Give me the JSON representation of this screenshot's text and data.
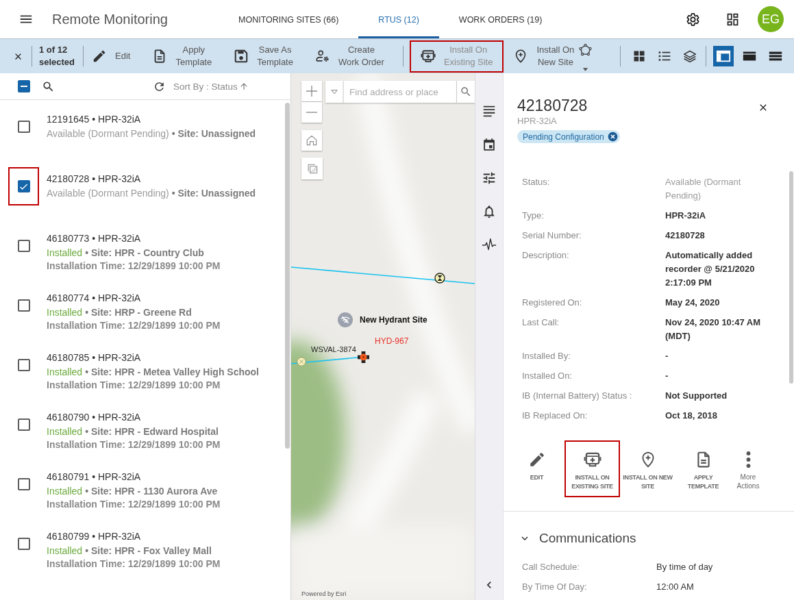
{
  "header": {
    "title": "Remote Monitoring",
    "tabs": [
      {
        "label": "MONITORING SITES (66)",
        "selected": false
      },
      {
        "label": "RTUS (12)",
        "selected": true
      },
      {
        "label": "WORK ORDERS (19)",
        "selected": false
      }
    ],
    "avatar": "EG"
  },
  "toolbar": {
    "selection": "1 of 12\nselected",
    "actions": [
      {
        "kind": "edit",
        "label": "Edit"
      },
      {
        "kind": "apply-template",
        "label": "Apply\nTemplate"
      },
      {
        "kind": "save-template",
        "label": "Save As\nTemplate"
      },
      {
        "kind": "work-order",
        "label": "Create\nWork Order"
      }
    ],
    "install_actions": [
      {
        "kind": "install-existing",
        "label": "Install On\nExisting Site",
        "disabled": true,
        "highlighted": true
      },
      {
        "kind": "install-new",
        "label": "Install On\nNew Site",
        "disabled": false,
        "highlighted": false
      }
    ],
    "view_modes": [
      {
        "selected": true
      },
      {
        "selected": false
      },
      {
        "selected": false
      }
    ]
  },
  "list": {
    "select_all": {
      "indeterminate": true
    },
    "sort": "Sort By : Status",
    "rows": [
      {
        "title": "12191645 • HPR-32iA",
        "status": {
          "text": "Available (Dormant Pending)",
          "color": "#9b9b9b"
        },
        "site": "• Site: Unassigned",
        "checked": false,
        "highlighted": false
      },
      {
        "title": "42180728 • HPR-32iA",
        "status": {
          "text": "Available (Dormant Pending)",
          "color": "#9b9b9b"
        },
        "site": "• Site: Unassigned",
        "checked": true,
        "highlighted": true
      },
      {
        "title": "46180773 • HPR-32iA",
        "status": {
          "text": "Installed",
          "color": "#6cab3e"
        },
        "site": "• Site: HPR - Country Club",
        "time": "Installation Time: 12/29/1899 10:00 PM",
        "checked": false,
        "highlighted": false
      },
      {
        "title": "46180774 • HPR-32iA",
        "status": {
          "text": "Installed",
          "color": "#6cab3e"
        },
        "site": "• Site: HRP - Greene Rd",
        "time": "Installation Time: 12/29/1899 10:00 PM",
        "checked": false,
        "highlighted": false
      },
      {
        "title": "46180785 • HPR-32iA",
        "status": {
          "text": "Installed",
          "color": "#6cab3e"
        },
        "site": "• Site: HPR - Metea Valley High School",
        "time": "Installation Time: 12/29/1899 10:00 PM",
        "checked": false,
        "highlighted": false
      },
      {
        "title": "46180790 • HPR-32iA",
        "status": {
          "text": "Installed",
          "color": "#6cab3e"
        },
        "site": "• Site: HPR - Edward Hospital",
        "time": "Installation Time: 12/29/1899 10:00 PM",
        "checked": false,
        "highlighted": false
      },
      {
        "title": "46180791 • HPR-32iA",
        "status": {
          "text": "Installed",
          "color": "#6cab3e"
        },
        "site": "• Site: HPR - 1130 Aurora Ave",
        "time": "Installation Time: 12/29/1899 10:00 PM",
        "checked": false,
        "highlighted": false
      },
      {
        "title": "46180799 • HPR-32iA",
        "status": {
          "text": "Installed",
          "color": "#6cab3e"
        },
        "site": "• Site: HPR - Fox Valley Mall",
        "time": "Installation Time: 12/29/1899 10:00 PM",
        "checked": false,
        "highlighted": false
      }
    ]
  },
  "map": {
    "search": {
      "placeholder": "Find address or place"
    },
    "features": [
      {
        "kind": "site",
        "label": "New Hydrant Site"
      },
      {
        "kind": "hydrant",
        "label": "HYD-967"
      },
      {
        "kind": "valve",
        "label": "WSVAL-3874"
      }
    ],
    "attribution": "Powered by Esri"
  },
  "details": {
    "title": "42180728",
    "subtitle": "HPR-32iA",
    "chip": "Pending Configuration",
    "fields": [
      {
        "label": "Status:",
        "value": "Available (Dormant Pending)",
        "muted": true
      },
      {
        "label": "Type:",
        "value": "HPR-32iA",
        "muted": false
      },
      {
        "label": "Serial Number:",
        "value": "42180728",
        "muted": false
      },
      {
        "label": "Description:",
        "value": "Automatically added recorder @ 5/21/2020 2:17:09 PM",
        "muted": false
      },
      {
        "label": "Registered On:",
        "value": "May 24, 2020",
        "muted": false
      },
      {
        "label": "Last Call:",
        "value": "Nov 24, 2020 10:47 AM (MDT)",
        "muted": false
      },
      {
        "label": "Installed By:",
        "value": "-",
        "muted": false
      },
      {
        "label": "Installed On:",
        "value": "-",
        "muted": false
      },
      {
        "label": "IB (Internal Battery) Status :",
        "value": "Not Supported",
        "muted": false
      },
      {
        "label": "IB Replaced On:",
        "value": "Oct 18, 2018",
        "muted": false
      }
    ],
    "actions": [
      {
        "kind": "edit",
        "label": "EDIT",
        "highlighted": false
      },
      {
        "kind": "install-existing",
        "label": "INSTALL ON EXISTING SITE",
        "highlighted": true
      },
      {
        "kind": "install-new",
        "label": "INSTALL ON NEW SITE",
        "highlighted": false
      },
      {
        "kind": "apply-template",
        "label": "APPLY TEMPLATE",
        "highlighted": false
      },
      {
        "kind": "more",
        "label": "More Actions",
        "highlighted": false
      }
    ],
    "sections": [
      {
        "title": "Communications",
        "expanded": true,
        "fields": [
          {
            "label": "Call Schedule:",
            "value": "By time of day"
          },
          {
            "label": "By Time Of Day:",
            "value": "12:00 AM"
          }
        ]
      }
    ]
  }
}
